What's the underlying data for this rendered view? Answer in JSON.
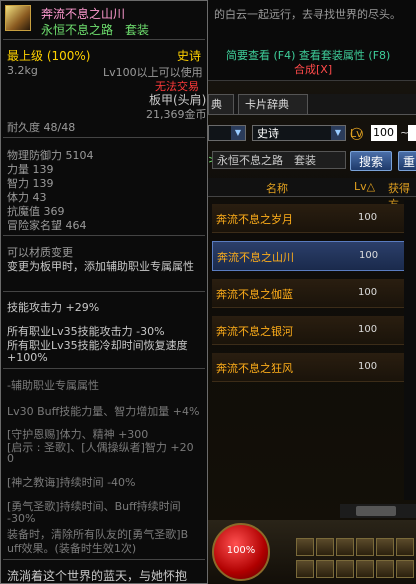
{
  "colors": {
    "epic": "#ffd200",
    "set": "#6fe06f",
    "title": "#ff9ad0",
    "warn": "#ff3a3a",
    "accent": "#e0a020"
  },
  "tooltip": {
    "icon": "item-crown-icon",
    "item_name": "奔流不息之山川",
    "set_name": "永恒不息之路　套装",
    "max_level": "最上级 (100%)",
    "rarity": "史诗",
    "weight": "3.2kg",
    "level_req": "Lv100以上可以使用",
    "trade": "无法交易",
    "slot": "板甲(头肩)",
    "price": "21,369金币",
    "durability": "耐久度 48/48",
    "stats": [
      "物理防御力 5104",
      "力量 139",
      "智力 139",
      "体力 43",
      "抗魔值 369",
      "冒险家名望 464"
    ],
    "notes": [
      "可以材质变更",
      "变更为板甲时，添加辅助职业专属属性"
    ],
    "skill_atk": "技能攻击力 +29%",
    "all_jobs_1": "所有职业Lv35技能攻击力 -30%",
    "all_jobs_2": "所有职业Lv35技能冷却时间恢复速度",
    "all_jobs_3": "+100%",
    "support_title": "-辅助职业专属属性",
    "support_lines": [
      "Lv30 Buff技能力量、智力增加量 +4%",
      "[守护恩赐]体力、精神 +300",
      "[启示 : 圣歌]、[人偶操纵者]智力 +20",
      "0",
      "[神之教诲]持续时间 -40%",
      "[勇气圣歌]持续时间、Buff持续时间",
      "-30%",
      "装备时，清除所有队友的[勇气圣歌]B",
      "uff效果。(装备时生效1次)"
    ],
    "story": "流淌着这个世界的蓝天，与她怀抱"
  },
  "panel": {
    "story": "的白云一起远行，去寻找世界的尽头。",
    "link_view": "简要查看 (F4) 查看套装属性 (F8)",
    "link_synth": "合成[X]",
    "tabs": [
      "典",
      "卡片辞典"
    ],
    "filter_select_1": "",
    "filter_rarity": "史诗",
    "lv_label": "Lv",
    "lv_min": "100",
    "lv_sep": "~",
    "set_filter": "永恒不息之路　套装",
    "search_button": "搜索",
    "reset_button": "重",
    "col_name": "名称",
    "col_lv": "Lv△",
    "col_obtain": "获得方",
    "rows": [
      {
        "name": "奔流不息之岁月",
        "lv": "100"
      },
      {
        "name": "奔流不息之山川",
        "lv": "100"
      },
      {
        "name": "奔流不息之伽蓝",
        "lv": "100"
      },
      {
        "name": "奔流不息之银河",
        "lv": "100"
      },
      {
        "name": "奔流不息之狂风",
        "lv": "100"
      }
    ],
    "hp": "100%"
  }
}
